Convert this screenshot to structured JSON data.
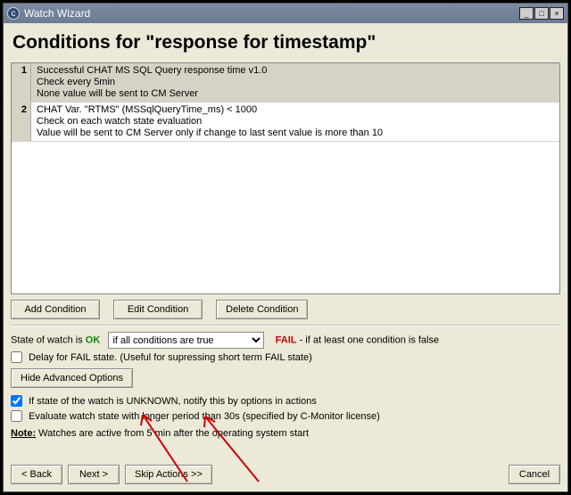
{
  "window": {
    "title": "Watch Wizard"
  },
  "page": {
    "title": "Conditions for \"response for timestamp\""
  },
  "conditions": [
    {
      "idx": "1",
      "line1": "Successful CHAT MS SQL Query response time v1.0",
      "line2": "Check every 5min",
      "line3": "None value will be sent to CM Server"
    },
    {
      "idx": "2",
      "line1": "CHAT Var. \"RTMS\" (MSSqlQueryTime_ms) < 1000",
      "line2": "Check on each watch state evaluation",
      "line3": "Value will be sent to CM Server only if change to last sent value is more than 10"
    }
  ],
  "condButtons": {
    "add": "Add Condition",
    "edit": "Edit Condition",
    "del": "Delete Condition"
  },
  "state": {
    "pre": "State of watch is ",
    "ok": "OK",
    "sel": "if all conditions are true",
    "fail": "FAIL",
    "post": " - if at least one condition is false"
  },
  "checks": {
    "delay": "Delay for FAIL state. (Useful for supressing short term FAIL state)",
    "hideAdv": "Hide Advanced Options",
    "unknown": "If state of the watch is UNKNOWN, notify this by options in actions",
    "longer": "Evaluate watch state with longer period than 30s (specified by C-Monitor license)"
  },
  "note": {
    "label": "Note:",
    "text": " Watches are active from 5 min after the operating system start"
  },
  "nav": {
    "back": "< Back",
    "next": "Next >",
    "skip": "Skip Actions >>",
    "cancel": "Cancel"
  }
}
